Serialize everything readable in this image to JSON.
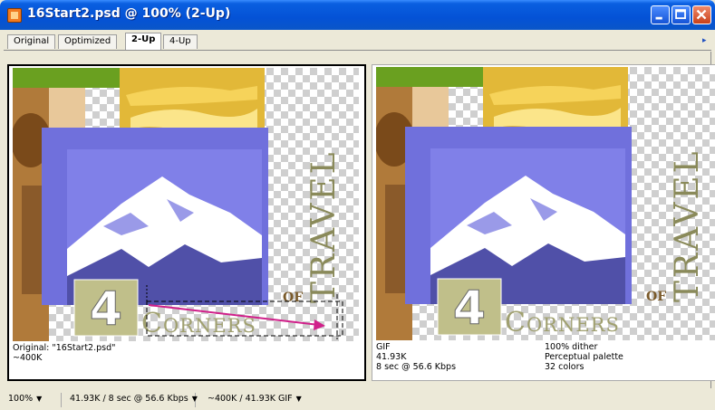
{
  "window": {
    "title": "16Start2.psd @ 100% (2-Up)",
    "icon": "photoshop-document-icon",
    "controls": [
      "minimize-icon",
      "maximize-icon",
      "close-icon"
    ]
  },
  "tabs": [
    {
      "label": "Original",
      "active": false
    },
    {
      "label": "Optimized",
      "active": false
    },
    {
      "label": "2-Up",
      "active": true
    },
    {
      "label": "4-Up",
      "active": false
    }
  ],
  "artwork": {
    "numeral": "4",
    "word_corners": "Corners",
    "word_of": "OF",
    "word_travel": "TRAVEL"
  },
  "left_panel": {
    "line1": "Original: \"16Start2.psd\"",
    "line2": "~400K"
  },
  "right_panel": {
    "col1": [
      "GIF",
      "41.93K",
      "8 sec @ 56.6 Kbps"
    ],
    "col2": [
      "100% dither",
      "Perceptual palette",
      "32 colors"
    ]
  },
  "statusbar": {
    "zoom": "100%",
    "download": "41.93K / 8 sec @ 56.6 Kbps",
    "size_compare": "~400K / 41.93K GIF"
  },
  "colors": {
    "title_blue": "#0452d6",
    "travel_olive": "#8a8a5a",
    "arrow_magenta": "#d0208a"
  }
}
